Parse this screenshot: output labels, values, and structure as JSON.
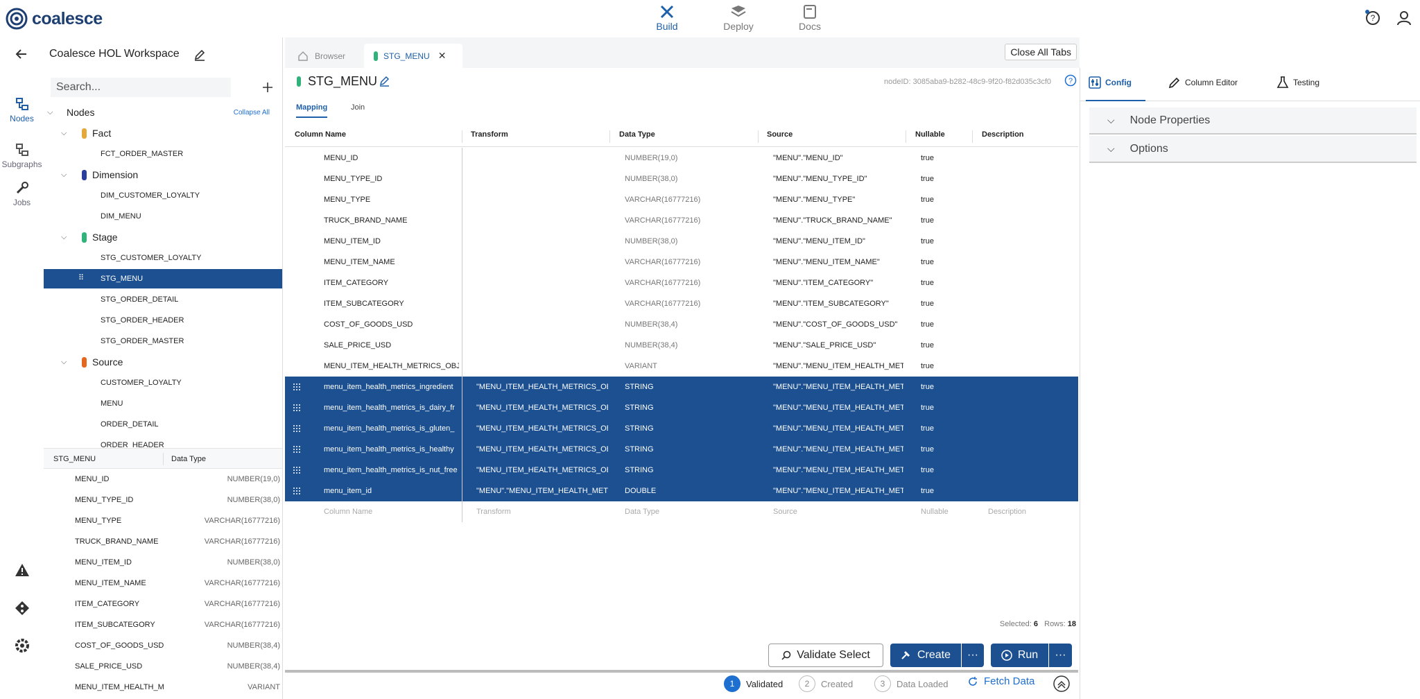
{
  "app": {
    "name": "coalesce"
  },
  "topnav": [
    {
      "label": "Build",
      "icon": "hammer-wrench-icon",
      "active": true
    },
    {
      "label": "Deploy",
      "icon": "deploy-icon",
      "active": false
    },
    {
      "label": "Docs",
      "icon": "docs-icon",
      "active": false
    }
  ],
  "leftrail": [
    {
      "label": "Nodes",
      "icon": "nodes-icon",
      "active": true
    },
    {
      "label": "Subgraphs",
      "icon": "subgraphs-icon",
      "active": false
    },
    {
      "label": "Jobs",
      "icon": "wrench-icon",
      "active": false
    }
  ],
  "workspace": {
    "name": "Coalesce HOL Workspace"
  },
  "search": {
    "placeholder": "Search..."
  },
  "tree": {
    "root_label": "Nodes",
    "collapse_all": "Collapse All",
    "groups": [
      {
        "label": "Fact",
        "color": "#e4a93a",
        "items": [
          "FCT_ORDER_MASTER"
        ]
      },
      {
        "label": "Dimension",
        "color": "#2b3ea0",
        "items": [
          "DIM_CUSTOMER_LOYALTY",
          "DIM_MENU"
        ]
      },
      {
        "label": "Stage",
        "color": "#2fb37a",
        "items": [
          "STG_CUSTOMER_LOYALTY",
          "STG_MENU",
          "STG_ORDER_DETAIL",
          "STG_ORDER_HEADER",
          "STG_ORDER_MASTER"
        ]
      },
      {
        "label": "Source",
        "color": "#e5671f",
        "items": [
          "CUSTOMER_LOYALTY",
          "MENU",
          "ORDER_DETAIL",
          "ORDER_HEADER"
        ]
      }
    ],
    "selected": "STG_MENU"
  },
  "column_panel": {
    "header_name": "STG_MENU",
    "header_type": "Data Type",
    "rows": [
      {
        "name": "MENU_ID",
        "type": "NUMBER(19,0)"
      },
      {
        "name": "MENU_TYPE_ID",
        "type": "NUMBER(38,0)"
      },
      {
        "name": "MENU_TYPE",
        "type": "VARCHAR(16777216)"
      },
      {
        "name": "TRUCK_BRAND_NAME",
        "type": "VARCHAR(16777216)"
      },
      {
        "name": "MENU_ITEM_ID",
        "type": "NUMBER(38,0)"
      },
      {
        "name": "MENU_ITEM_NAME",
        "type": "VARCHAR(16777216)"
      },
      {
        "name": "ITEM_CATEGORY",
        "type": "VARCHAR(16777216)"
      },
      {
        "name": "ITEM_SUBCATEGORY",
        "type": "VARCHAR(16777216)"
      },
      {
        "name": "COST_OF_GOODS_USD",
        "type": "NUMBER(38,4)"
      },
      {
        "name": "SALE_PRICE_USD",
        "type": "NUMBER(38,4)"
      },
      {
        "name": "MENU_ITEM_HEALTH_M",
        "type": "VARIANT"
      }
    ]
  },
  "tabs": {
    "items": [
      {
        "label": "Browser",
        "icon": "home-icon",
        "active": false
      },
      {
        "label": "STG_MENU",
        "icon": "stage-node-icon",
        "active": true,
        "closable": true
      }
    ],
    "close_all": "Close All Tabs"
  },
  "node": {
    "title": "STG_MENU",
    "node_id": "nodeID: 3085aba9-b282-48c9-9f20-f82d035c3cf0",
    "subtabs": [
      "Mapping",
      "Join"
    ],
    "active_subtab": "Mapping"
  },
  "grid": {
    "headers": [
      "Column Name",
      "Transform",
      "Data Type",
      "Source",
      "Nullable",
      "Description"
    ],
    "rows": [
      {
        "name": "MENU_ID",
        "transform": "",
        "type": "NUMBER(19,0)",
        "source": "\"MENU\".\"MENU_ID\"",
        "nullable": "true",
        "selected": false
      },
      {
        "name": "MENU_TYPE_ID",
        "transform": "",
        "type": "NUMBER(38,0)",
        "source": "\"MENU\".\"MENU_TYPE_ID\"",
        "nullable": "true",
        "selected": false
      },
      {
        "name": "MENU_TYPE",
        "transform": "",
        "type": "VARCHAR(16777216)",
        "source": "\"MENU\".\"MENU_TYPE\"",
        "nullable": "true",
        "selected": false
      },
      {
        "name": "TRUCK_BRAND_NAME",
        "transform": "",
        "type": "VARCHAR(16777216)",
        "source": "\"MENU\".\"TRUCK_BRAND_NAME\"",
        "nullable": "true",
        "selected": false
      },
      {
        "name": "MENU_ITEM_ID",
        "transform": "",
        "type": "NUMBER(38,0)",
        "source": "\"MENU\".\"MENU_ITEM_ID\"",
        "nullable": "true",
        "selected": false
      },
      {
        "name": "MENU_ITEM_NAME",
        "transform": "",
        "type": "VARCHAR(16777216)",
        "source": "\"MENU\".\"MENU_ITEM_NAME\"",
        "nullable": "true",
        "selected": false
      },
      {
        "name": "ITEM_CATEGORY",
        "transform": "",
        "type": "VARCHAR(16777216)",
        "source": "\"MENU\".\"ITEM_CATEGORY\"",
        "nullable": "true",
        "selected": false
      },
      {
        "name": "ITEM_SUBCATEGORY",
        "transform": "",
        "type": "VARCHAR(16777216)",
        "source": "\"MENU\".\"ITEM_SUBCATEGORY\"",
        "nullable": "true",
        "selected": false
      },
      {
        "name": "COST_OF_GOODS_USD",
        "transform": "",
        "type": "NUMBER(38,4)",
        "source": "\"MENU\".\"COST_OF_GOODS_USD\"",
        "nullable": "true",
        "selected": false
      },
      {
        "name": "SALE_PRICE_USD",
        "transform": "",
        "type": "NUMBER(38,4)",
        "source": "\"MENU\".\"SALE_PRICE_USD\"",
        "nullable": "true",
        "selected": false
      },
      {
        "name": "MENU_ITEM_HEALTH_METRICS_OBJ",
        "transform": "",
        "type": "VARIANT",
        "source": "\"MENU\".\"MENU_ITEM_HEALTH_METR",
        "nullable": "true",
        "selected": false
      },
      {
        "name": "menu_item_health_metrics_ingredient",
        "transform": "\"MENU_ITEM_HEALTH_METRICS_OB.",
        "type": "STRING",
        "source": "\"MENU\".\"MENU_ITEM_HEALTH_METR",
        "nullable": "true",
        "selected": true
      },
      {
        "name": "menu_item_health_metrics_is_dairy_fr",
        "transform": "\"MENU_ITEM_HEALTH_METRICS_OB.",
        "type": "STRING",
        "source": "\"MENU\".\"MENU_ITEM_HEALTH_METR",
        "nullable": "true",
        "selected": true
      },
      {
        "name": "menu_item_health_metrics_is_gluten_",
        "transform": "\"MENU_ITEM_HEALTH_METRICS_OB.",
        "type": "STRING",
        "source": "\"MENU\".\"MENU_ITEM_HEALTH_METR",
        "nullable": "true",
        "selected": true
      },
      {
        "name": "menu_item_health_metrics_is_healthy",
        "transform": "\"MENU_ITEM_HEALTH_METRICS_OB.",
        "type": "STRING",
        "source": "\"MENU\".\"MENU_ITEM_HEALTH_METR",
        "nullable": "true",
        "selected": true
      },
      {
        "name": "menu_item_health_metrics_is_nut_free",
        "transform": "\"MENU_ITEM_HEALTH_METRICS_OB.",
        "type": "STRING",
        "source": "\"MENU\".\"MENU_ITEM_HEALTH_METR",
        "nullable": "true",
        "selected": true
      },
      {
        "name": "menu_item_id",
        "transform": "\"MENU\".\"MENU_ITEM_HEALTH_METR",
        "type": "DOUBLE",
        "source": "\"MENU\".\"MENU_ITEM_HEALTH_METR",
        "nullable": "true",
        "selected": true
      }
    ],
    "placeholder_row": [
      "Column Name",
      "Transform",
      "Data Type",
      "Source",
      "Nullable",
      "Description"
    ]
  },
  "status": {
    "selected_label": "Selected:",
    "selected_count": "6",
    "rows_label": "Rows:",
    "rows_count": "18"
  },
  "actions": {
    "validate": "Validate Select",
    "create": "Create",
    "run": "Run",
    "more": "···"
  },
  "steps": [
    {
      "num": "1",
      "label": "Validated",
      "done": true
    },
    {
      "num": "2",
      "label": "Created",
      "done": false
    },
    {
      "num": "3",
      "label": "Data Loaded",
      "done": false
    }
  ],
  "fetch_data": "Fetch Data",
  "right_panel": {
    "tabs": [
      {
        "label": "Config",
        "icon": "config-icon",
        "active": true
      },
      {
        "label": "Column Editor",
        "icon": "pencil-icon",
        "active": false
      },
      {
        "label": "Testing",
        "icon": "flask-icon",
        "active": false
      }
    ],
    "sections": [
      "Node Properties",
      "Options"
    ]
  },
  "colors": {
    "accent": "#1d5fa8",
    "selected_row": "#1c5090"
  }
}
